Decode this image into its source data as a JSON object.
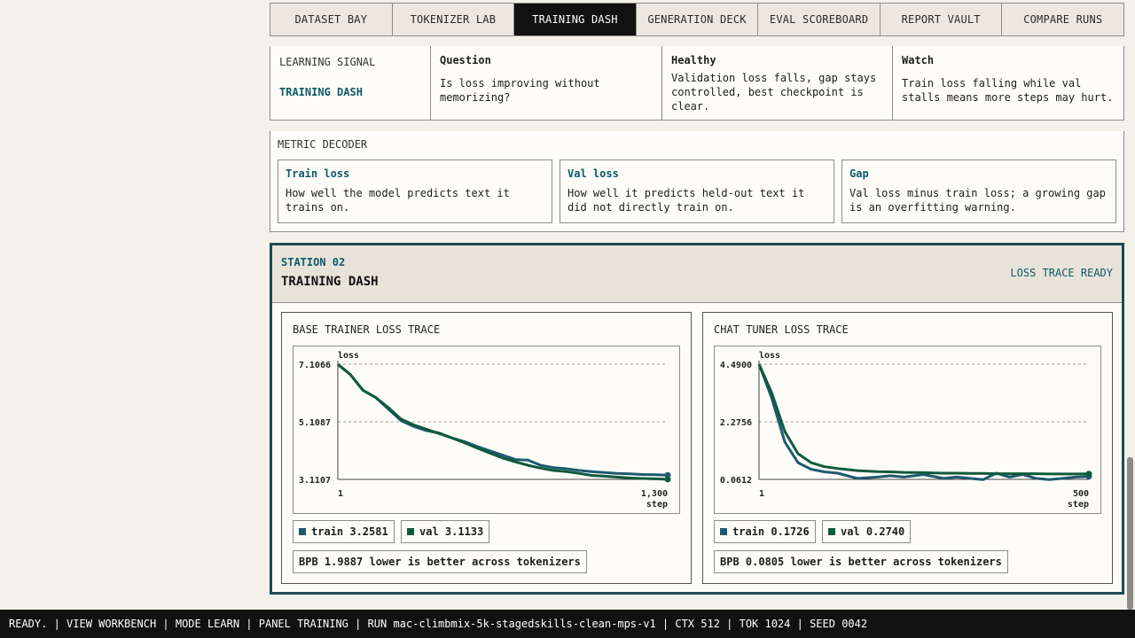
{
  "tabs": [
    "DATASET BAY",
    "TOKENIZER LAB",
    "TRAINING DASH",
    "GENERATION DECK",
    "EVAL SCOREBOARD",
    "REPORT VAULT",
    "COMPARE RUNS"
  ],
  "active_tab": "TRAINING DASH",
  "signal": {
    "label": "LEARNING SIGNAL",
    "sub": "TRAINING DASH",
    "question_h": "Question",
    "question": "Is loss improving without memorizing?",
    "healthy_h": "Healthy",
    "healthy": "Validation loss falls, gap stays controlled, best checkpoint is clear.",
    "watch_h": "Watch",
    "watch": "Train loss falling while val stalls means more steps may hurt."
  },
  "decoder": {
    "title": "METRIC DECODER",
    "cards": [
      {
        "h": "Train loss",
        "t": "How well the model predicts text it trains on."
      },
      {
        "h": "Val loss",
        "t": "How well it predicts held-out text it did not directly train on."
      },
      {
        "h": "Gap",
        "t": "Val loss minus train loss; a growing gap is an overfitting warning."
      }
    ]
  },
  "station": {
    "num": "STATION 02",
    "name": "TRAINING DASH",
    "status": "LOSS TRACE READY"
  },
  "colors": {
    "train": "#1d5a70",
    "val": "#0f5a3c"
  },
  "panels": [
    {
      "title": "BASE TRAINER LOSS TRACE",
      "train_label": "train 3.2581",
      "val_label": "val 3.1133",
      "bpb": "BPB 1.9887 lower is better across tokenizers"
    },
    {
      "title": "CHAT TUNER LOSS TRACE",
      "train_label": "train 0.1726",
      "val_label": "val 0.2740",
      "bpb": "BPB 0.0805 lower is better across tokenizers"
    }
  ],
  "chart_data": [
    {
      "type": "line",
      "title": "BASE TRAINER LOSS TRACE",
      "ylabel": "loss",
      "xlabel": "step",
      "yticks": [
        "7.1066",
        "5.1087",
        "3.1107"
      ],
      "xticks": [
        "1",
        "1,300"
      ],
      "ylim": [
        3.1107,
        7.1066
      ],
      "xlim": [
        1,
        1300
      ],
      "grid": true,
      "series": [
        {
          "name": "train",
          "x": [
            1,
            50,
            100,
            150,
            200,
            250,
            300,
            350,
            400,
            450,
            500,
            550,
            600,
            650,
            700,
            750,
            800,
            850,
            900,
            950,
            1000,
            1050,
            1100,
            1150,
            1200,
            1250,
            1300
          ],
          "y": [
            7.1,
            6.75,
            6.2,
            5.95,
            5.55,
            5.15,
            4.95,
            4.8,
            4.72,
            4.55,
            4.42,
            4.25,
            4.1,
            3.95,
            3.8,
            3.78,
            3.6,
            3.52,
            3.48,
            3.42,
            3.38,
            3.35,
            3.32,
            3.3,
            3.28,
            3.27,
            3.2581
          ]
        },
        {
          "name": "val",
          "x": [
            1,
            50,
            100,
            150,
            200,
            250,
            300,
            350,
            400,
            450,
            500,
            550,
            600,
            650,
            700,
            750,
            800,
            850,
            900,
            950,
            1000,
            1050,
            1100,
            1150,
            1200,
            1250,
            1300
          ],
          "y": [
            7.1,
            6.75,
            6.2,
            5.95,
            5.6,
            5.2,
            5.0,
            4.85,
            4.7,
            4.55,
            4.38,
            4.2,
            4.02,
            3.85,
            3.72,
            3.6,
            3.5,
            3.42,
            3.38,
            3.32,
            3.25,
            3.22,
            3.19,
            3.16,
            3.14,
            3.13,
            3.1133
          ]
        }
      ]
    },
    {
      "type": "line",
      "title": "CHAT TUNER LOSS TRACE",
      "ylabel": "loss",
      "xlabel": "step",
      "yticks": [
        "4.4900",
        "2.2756",
        "0.0612"
      ],
      "xticks": [
        "1",
        "500"
      ],
      "ylim": [
        0.0612,
        4.49
      ],
      "xlim": [
        1,
        500
      ],
      "grid": true,
      "series": [
        {
          "name": "train",
          "x": [
            1,
            20,
            40,
            60,
            80,
            100,
            120,
            150,
            180,
            200,
            220,
            250,
            280,
            300,
            320,
            340,
            360,
            380,
            400,
            420,
            440,
            460,
            480,
            500
          ],
          "y": [
            4.49,
            3.2,
            1.5,
            0.7,
            0.45,
            0.35,
            0.3,
            0.1,
            0.15,
            0.2,
            0.15,
            0.25,
            0.1,
            0.15,
            0.1,
            0.05,
            0.3,
            0.15,
            0.25,
            0.1,
            0.05,
            0.1,
            0.15,
            0.1726
          ]
        },
        {
          "name": "val",
          "x": [
            1,
            20,
            40,
            60,
            80,
            100,
            120,
            150,
            180,
            200,
            220,
            250,
            280,
            300,
            320,
            340,
            360,
            380,
            400,
            420,
            440,
            460,
            480,
            500
          ],
          "y": [
            4.49,
            3.4,
            1.9,
            1.05,
            0.7,
            0.55,
            0.48,
            0.4,
            0.36,
            0.35,
            0.33,
            0.32,
            0.3,
            0.3,
            0.29,
            0.29,
            0.28,
            0.28,
            0.28,
            0.28,
            0.27,
            0.27,
            0.27,
            0.274
          ]
        }
      ]
    }
  ],
  "statusbar": "READY. | VIEW WORKBENCH | MODE LEARN | PANEL TRAINING | RUN mac-climbmix-5k-stagedskills-clean-mps-v1 | CTX 512 | TOK 1024 | SEED 0042"
}
